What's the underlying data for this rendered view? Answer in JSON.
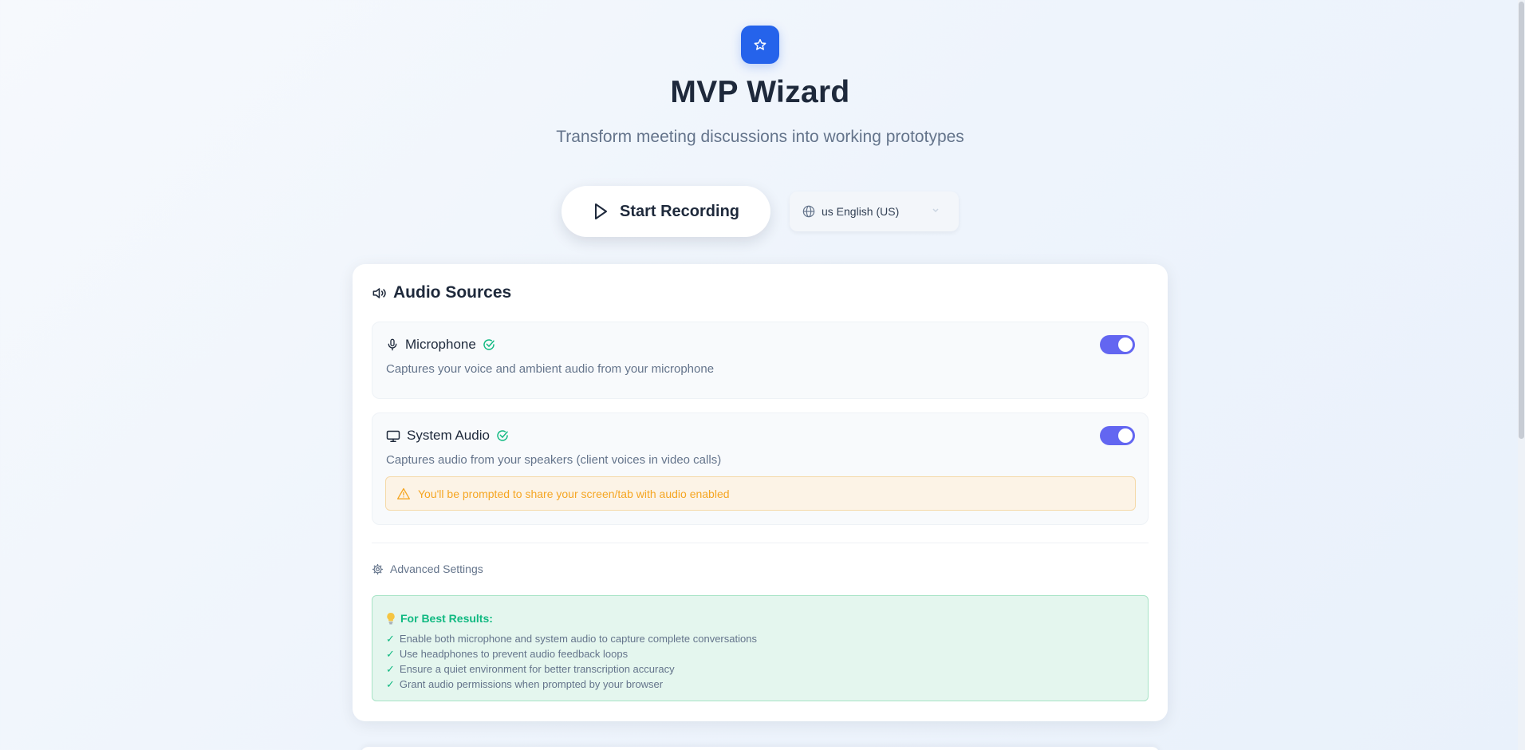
{
  "app": {
    "title": "MVP Wizard",
    "subtitle": "Transform meeting discussions into working prototypes",
    "logo_icon": "star-icon",
    "accent_color": "#2563eb"
  },
  "controls": {
    "record_label": "Start Recording",
    "record_icon": "play-icon",
    "language_value": "us English (US)",
    "language_icon": "globe-icon"
  },
  "audio_sources": {
    "heading": "Audio Sources",
    "heading_icon": "speaker-icon",
    "microphone": {
      "label": "Microphone",
      "description": "Captures your voice and ambient audio from your microphone",
      "enabled": true,
      "icon": "microphone-icon"
    },
    "system_audio": {
      "label": "System Audio",
      "description": "Captures audio from your speakers (client voices in video calls)",
      "enabled": true,
      "icon": "monitor-icon",
      "warning": "You'll be prompted to share your screen/tab with audio enabled"
    },
    "toggle_color": "#6366f1",
    "verified_color": "#10b981"
  },
  "advanced": {
    "label": "Advanced Settings",
    "icon": "gear-icon"
  },
  "tips": {
    "title": "For Best Results:",
    "icon": "lightbulb-icon",
    "items": [
      "Enable both microphone and system audio to capture complete conversations",
      "Use headphones to prevent audio feedback loops",
      "Ensure a quiet environment for better transcription accuracy",
      "Grant audio permissions when prompted by your browser"
    ]
  }
}
